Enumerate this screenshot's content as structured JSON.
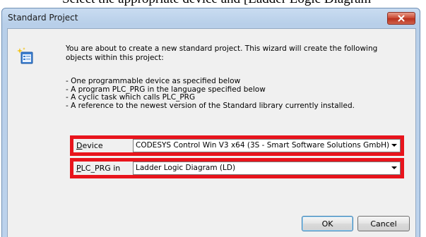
{
  "top_caption": "Select the appropriate device and [Ladder Logic Diagram",
  "window": {
    "title": "Standard Project",
    "close_glyph": "✕"
  },
  "intro": {
    "text": "You are about to create a new standard project. This wizard will create the following objects within this project:"
  },
  "bullets": [
    "- One programmable device as specified below",
    "- A program PLC_PRG in the language specified below",
    "- A cyclic task which calls PLC_PRG",
    "- A reference to the newest version of the Standard library currently installed."
  ],
  "device": {
    "label_prefix": "",
    "label_underlined": "D",
    "label_rest": "evice",
    "value": "CODESYS Control Win V3 x64 (3S - Smart Software Solutions GmbH)"
  },
  "plc_prg": {
    "label_underlined": "P",
    "label_rest": "LC_PRG in",
    "value": "Ladder Logic Diagram (LD)"
  },
  "buttons": {
    "ok": "OK",
    "cancel": "Cancel"
  },
  "colors": {
    "highlight": "#e8141c",
    "close_button": "#c9452f"
  }
}
